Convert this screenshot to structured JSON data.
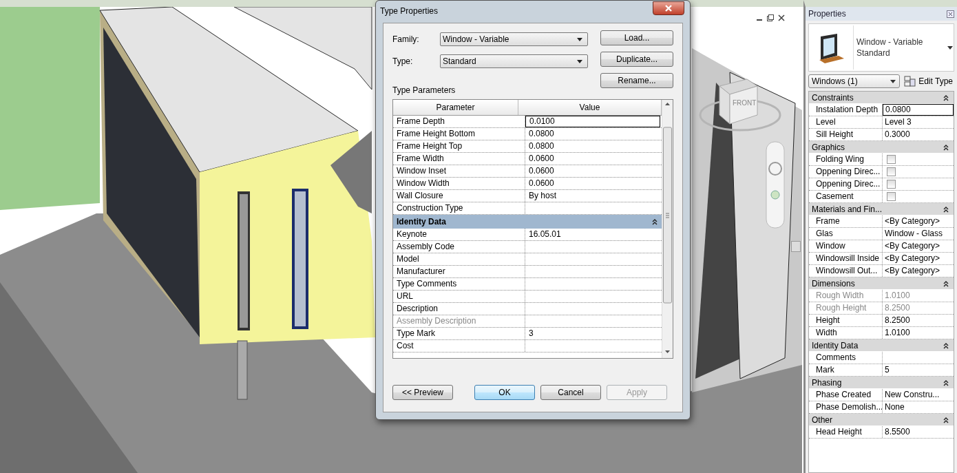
{
  "viewport": {
    "viewcube": {
      "face": "FRONT"
    }
  },
  "dialog": {
    "title": "Type Properties",
    "fields": [
      {
        "label": "Family:",
        "value": "Window - Variable"
      },
      {
        "label": "Type:",
        "value": "Standard"
      }
    ],
    "side_buttons": [
      "Load...",
      "Duplicate...",
      "Rename..."
    ],
    "section_label": "Type Parameters",
    "table": {
      "columns": [
        "Parameter",
        "Value"
      ],
      "rows": [
        {
          "kind": "param",
          "name": "Frame Depth",
          "value": "0.0100",
          "selected": true,
          "disabled": false
        },
        {
          "kind": "param",
          "name": "Frame Height Bottom",
          "value": "0.0800",
          "selected": false,
          "disabled": false
        },
        {
          "kind": "param",
          "name": "Frame Height Top",
          "value": "0.0800",
          "selected": false,
          "disabled": false
        },
        {
          "kind": "param",
          "name": "Frame Width",
          "value": "0.0600",
          "selected": false,
          "disabled": false
        },
        {
          "kind": "param",
          "name": "Window Inset",
          "value": "0.0600",
          "selected": false,
          "disabled": false
        },
        {
          "kind": "param",
          "name": "Window Width",
          "value": "0.0600",
          "selected": false,
          "disabled": false
        },
        {
          "kind": "param",
          "name": "Wall Closure",
          "value": "By host",
          "selected": false,
          "disabled": false
        },
        {
          "kind": "param",
          "name": "Construction Type",
          "selected": false,
          "disabled": false
        },
        {
          "kind": "group",
          "name": "Identity Data",
          "expanded": true
        },
        {
          "kind": "param",
          "name": "Keynote",
          "value": "16.05.01",
          "selected": false,
          "disabled": false
        },
        {
          "kind": "param",
          "name": "Assembly Code",
          "selected": false,
          "disabled": false
        },
        {
          "kind": "param",
          "name": "Model",
          "selected": false,
          "disabled": false
        },
        {
          "kind": "param",
          "name": "Manufacturer",
          "selected": false,
          "disabled": false
        },
        {
          "kind": "param",
          "name": "Type Comments",
          "selected": false,
          "disabled": false
        },
        {
          "kind": "param",
          "name": "URL",
          "selected": false,
          "disabled": false
        },
        {
          "kind": "param",
          "name": "Description",
          "selected": false,
          "disabled": false
        },
        {
          "kind": "param",
          "name": "Assembly Description",
          "selected": false,
          "disabled": true
        },
        {
          "kind": "param",
          "name": "Type Mark",
          "value": "3",
          "selected": false,
          "disabled": false
        },
        {
          "kind": "param",
          "name": "Cost",
          "selected": false,
          "disabled": false
        }
      ]
    },
    "footer": {
      "preview": "<< Preview",
      "buttons": [
        {
          "label": "OK",
          "default": true,
          "disabled": false
        },
        {
          "label": "Cancel",
          "default": false,
          "disabled": false
        },
        {
          "label": "Apply",
          "default": false,
          "disabled": true
        }
      ]
    }
  },
  "properties": {
    "title": "Properties",
    "type_lines": [
      "Window - Variable",
      "Standard"
    ],
    "selector": "Windows (1)",
    "edit_type": "Edit Type",
    "groups": [
      {
        "name": "Constraints",
        "expanded": true,
        "rows": [
          {
            "kind": "text",
            "label": "Instalation Depth",
            "value": "0.0800",
            "selected": true,
            "disabled": false
          },
          {
            "kind": "text",
            "label": "Level",
            "value": "Level 3",
            "selected": false,
            "disabled": false
          },
          {
            "kind": "text",
            "label": "Sill Height",
            "value": "0.3000",
            "selected": false,
            "disabled": false
          }
        ]
      },
      {
        "name": "Graphics",
        "expanded": true,
        "rows": [
          {
            "kind": "checkbox",
            "label": "Folding Wing",
            "checked": false,
            "selected": false,
            "disabled": false
          },
          {
            "kind": "checkbox",
            "label": "Oppening Direc...",
            "checked": false,
            "selected": false,
            "disabled": false
          },
          {
            "kind": "checkbox",
            "label": "Oppening Direc...",
            "checked": false,
            "selected": false,
            "disabled": false
          },
          {
            "kind": "checkbox",
            "label": "Casement",
            "checked": false,
            "selected": false,
            "disabled": false
          }
        ]
      },
      {
        "name": "Materials and Fin...",
        "expanded": true,
        "rows": [
          {
            "kind": "text",
            "label": "Frame",
            "value": "<By Category>",
            "selected": false,
            "disabled": false
          },
          {
            "kind": "text",
            "label": "Glas",
            "value": "Window - Glass",
            "selected": false,
            "disabled": false
          },
          {
            "kind": "text",
            "label": "Window",
            "value": "<By Category>",
            "selected": false,
            "disabled": false
          },
          {
            "kind": "text",
            "label": "Windowsill Inside",
            "value": "<By Category>",
            "selected": false,
            "disabled": false
          },
          {
            "kind": "text",
            "label": "Windowsill Out...",
            "value": "<By Category>",
            "selected": false,
            "disabled": false
          }
        ]
      },
      {
        "name": "Dimensions",
        "expanded": true,
        "rows": [
          {
            "kind": "text",
            "label": "Rough Width",
            "value": "1.0100",
            "selected": false,
            "disabled": true
          },
          {
            "kind": "text",
            "label": "Rough Height",
            "value": "8.2500",
            "selected": false,
            "disabled": true
          },
          {
            "kind": "text",
            "label": "Height",
            "value": "8.2500",
            "selected": false,
            "disabled": false
          },
          {
            "kind": "text",
            "label": "Width",
            "value": "1.0100",
            "selected": false,
            "disabled": false
          }
        ]
      },
      {
        "name": "Identity Data",
        "expanded": true,
        "rows": [
          {
            "kind": "text",
            "label": "Comments",
            "selected": false,
            "disabled": false
          },
          {
            "kind": "text",
            "label": "Mark",
            "value": "5",
            "selected": false,
            "disabled": false
          }
        ]
      },
      {
        "name": "Phasing",
        "expanded": true,
        "rows": [
          {
            "kind": "text",
            "label": "Phase Created",
            "value": "New Constru...",
            "selected": false,
            "disabled": false
          },
          {
            "kind": "text",
            "label": "Phase Demolish...",
            "value": "None",
            "selected": false,
            "disabled": false
          }
        ]
      },
      {
        "name": "Other",
        "expanded": true,
        "rows": [
          {
            "kind": "text",
            "label": "Head Height",
            "value": "8.5500",
            "selected": false,
            "disabled": false
          }
        ]
      }
    ]
  }
}
